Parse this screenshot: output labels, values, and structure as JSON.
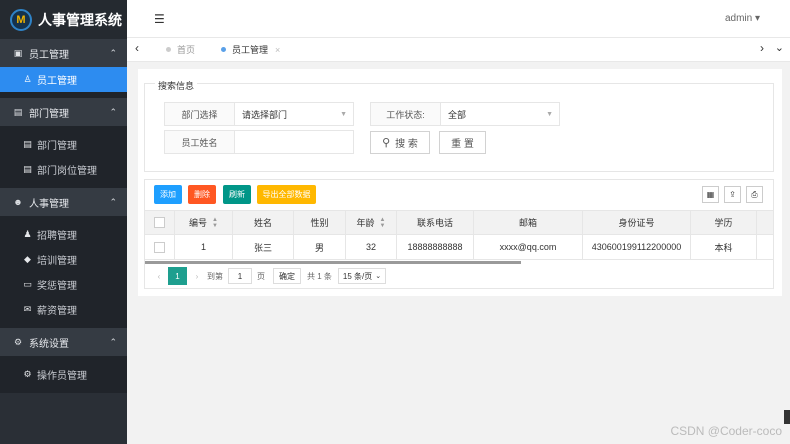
{
  "app": {
    "logo_glyph": "M",
    "title": "人事管理系统"
  },
  "sidebar": {
    "groups": [
      {
        "title": "员工管理",
        "icon": "id-card-icon",
        "items": [
          {
            "label": "员工管理",
            "icon": "person-icon",
            "active": true
          }
        ]
      },
      {
        "title": "部门管理",
        "icon": "address-card-icon",
        "items": [
          {
            "label": "部门管理",
            "icon": "address-card-icon"
          },
          {
            "label": "部门岗位管理",
            "icon": "address-card-icon"
          }
        ]
      },
      {
        "title": "人事管理",
        "icon": "users-icon",
        "items": [
          {
            "label": "招聘管理",
            "icon": "user-plus-icon"
          },
          {
            "label": "培训管理",
            "icon": "graduation-cap-icon"
          },
          {
            "label": "奖惩管理",
            "icon": "monitor-icon"
          },
          {
            "label": "薪资管理",
            "icon": "envelope-icon"
          }
        ]
      },
      {
        "title": "系统设置",
        "icon": "cogs-icon",
        "items": [
          {
            "label": "操作员管理",
            "icon": "cogs-icon"
          }
        ]
      }
    ]
  },
  "topbar": {
    "menu_icon": "☰",
    "user": "admin ▾"
  },
  "tabs": {
    "prev": "‹",
    "next": "›",
    "more": "⌄",
    "items": [
      {
        "label": "首页"
      },
      {
        "label": "员工管理",
        "close": "×"
      }
    ]
  },
  "search": {
    "legend": "搜索信息",
    "dept_label": "部门选择",
    "dept_value": "请选择部门",
    "status_label": "工作状态:",
    "status_value": "全部",
    "name_label": "员工姓名",
    "name_value": "",
    "search_btn": "搜 索",
    "reset_btn": "重 置"
  },
  "toolbar": {
    "buttons": [
      {
        "label": "添加",
        "color": "#1e9fff"
      },
      {
        "label": "删除",
        "color": "#ff5722"
      },
      {
        "label": "刷新",
        "color": "#009688"
      },
      {
        "label": "导出全部数据",
        "color": "#ffb800"
      }
    ],
    "icons": [
      {
        "name": "columns-icon",
        "glyph": "▦"
      },
      {
        "name": "export-icon",
        "glyph": "⇪"
      },
      {
        "name": "print-icon",
        "glyph": "⎙"
      }
    ]
  },
  "table": {
    "headers": [
      "编号",
      "姓名",
      "性别",
      "年龄",
      "联系电话",
      "邮箱",
      "身份证号",
      "学历"
    ],
    "rows": [
      [
        "1",
        "张三",
        "男",
        "32",
        "18888888888",
        "xxxx@qq.com",
        "430600199112200000",
        "本科"
      ]
    ]
  },
  "pager": {
    "prev": "‹",
    "current": "1",
    "next": "›",
    "goto": "到第",
    "page_input": "1",
    "page_unit": "页",
    "confirm": "确定",
    "total": "共 1 条",
    "size": "15 条/页"
  },
  "watermark": "CSDN @Coder-coco"
}
